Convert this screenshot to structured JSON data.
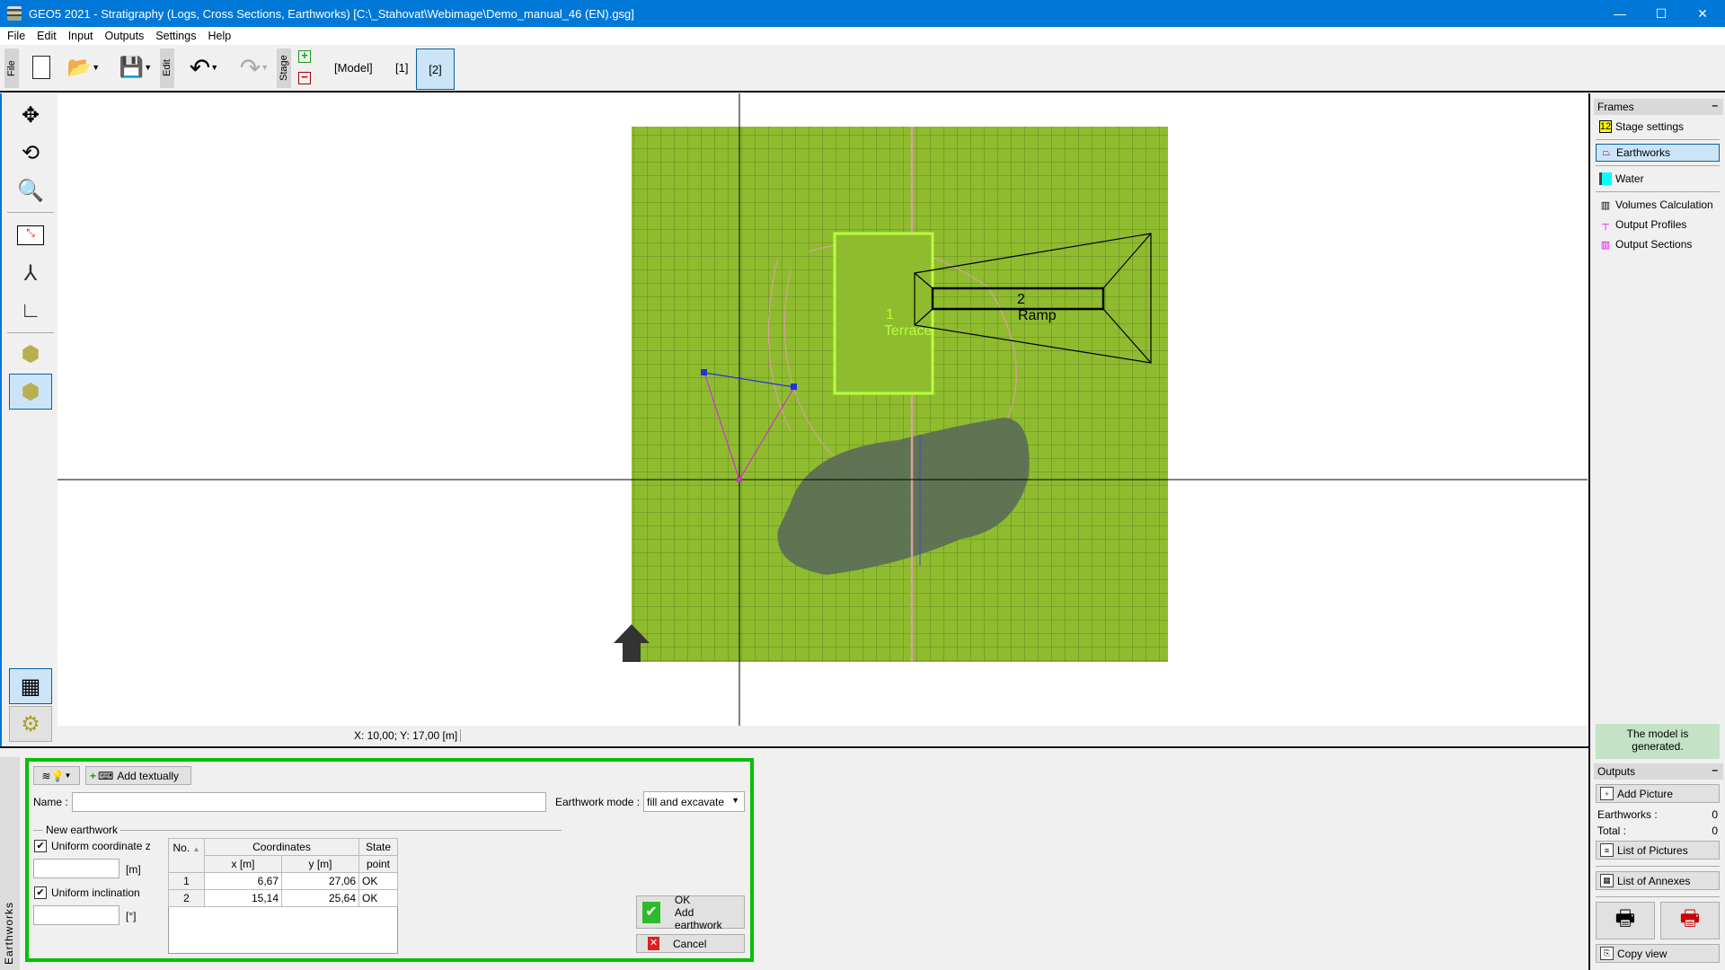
{
  "window": {
    "title": "GEO5 2021 - Stratigraphy (Logs, Cross Sections, Earthworks) [C:\\_Stahovat\\Webimage\\Demo_manual_46 (EN).gsg]",
    "controls": {
      "minimize": "—",
      "maximize": "☐",
      "close": "✕"
    }
  },
  "menu": [
    "File",
    "Edit",
    "Input",
    "Outputs",
    "Settings",
    "Help"
  ],
  "toolbar": {
    "file_label": "File",
    "edit_label": "Edit",
    "stage_label": "Stage",
    "stages": [
      "[Model]",
      "[1]",
      "[2]"
    ],
    "active_stage": "[2]"
  },
  "canvas": {
    "terrace_number": "1",
    "terrace_label": "Terrace",
    "ramp_number": "2",
    "ramp_label": "Ramp",
    "colors": {
      "terrain": "#8fbc2f",
      "terrace": "#b8ff3c",
      "pit": "#5a6b58"
    }
  },
  "status": {
    "coords": "X: 10,00; Y: 17,00 [m]"
  },
  "right_panel": {
    "frames_title": "Frames",
    "frames": [
      {
        "label": "Stage settings",
        "icon": "stage-settings-icon"
      },
      {
        "label": "Earthworks",
        "icon": "earthworks-icon",
        "selected": true
      },
      {
        "label": "Water",
        "icon": "water-icon"
      },
      {
        "label": "Volumes Calculation",
        "icon": "volumes-icon"
      },
      {
        "label": "Output Profiles",
        "icon": "output-profiles-icon"
      },
      {
        "label": "Output Sections",
        "icon": "output-sections-icon"
      }
    ],
    "model_status": "The model is generated.",
    "outputs_title": "Outputs",
    "add_picture": "Add Picture",
    "earthworks_label": "Earthworks :",
    "earthworks_count": "0",
    "total_label": "Total :",
    "total_count": "0",
    "list_pictures": "List of Pictures",
    "list_annexes": "List of Annexes",
    "copy_view": "Copy view"
  },
  "bottom": {
    "tab_label": "Earthworks",
    "add_textually": "Add textually",
    "name_label": "Name :",
    "name_value": "",
    "mode_label": "Earthwork mode :",
    "mode_value": "fill and excavate",
    "group_label": "New earthwork",
    "uniform_z_label": "Uniform coordinate z",
    "uniform_z_checked": true,
    "z_value": "",
    "z_unit": "[m]",
    "uniform_incl_label": "Uniform inclination",
    "uniform_incl_checked": true,
    "incl_value": "",
    "incl_unit": "[°]",
    "table": {
      "h_no": "No.",
      "h_coords": "Coordinates",
      "h_state1": "State",
      "h_state2": "point",
      "h_x": "x [m]",
      "h_y": "y [m]",
      "rows": [
        {
          "no": "1",
          "x": "6,67",
          "y": "27,06",
          "state": "OK"
        },
        {
          "no": "2",
          "x": "15,14",
          "y": "25,64",
          "state": "OK"
        }
      ]
    },
    "ok_label": "OK",
    "ok_sub": "Add earthwork",
    "cancel_label": "Cancel"
  }
}
